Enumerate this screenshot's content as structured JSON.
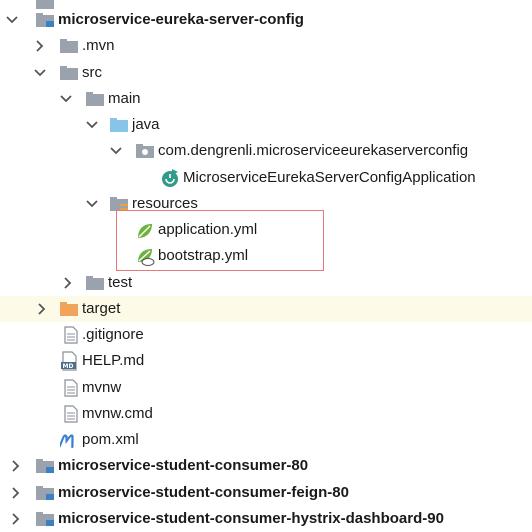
{
  "tree": {
    "root": {
      "label": "microservice-eureka-server-config"
    },
    "mvn": {
      "label": ".mvn"
    },
    "src": {
      "label": "src"
    },
    "main": {
      "label": "main"
    },
    "java": {
      "label": "java"
    },
    "package": {
      "label": "com.dengrenli.microserviceeurekaserverconfig"
    },
    "app_class": {
      "label": "MicroserviceEurekaServerConfigApplication"
    },
    "resources": {
      "label": "resources"
    },
    "application_yml": {
      "label": "application.yml"
    },
    "bootstrap_yml": {
      "label": "bootstrap.yml"
    },
    "test": {
      "label": "test"
    },
    "target": {
      "label": "target"
    },
    "gitignore": {
      "label": ".gitignore"
    },
    "help_md": {
      "label": "HELP.md"
    },
    "mvnw": {
      "label": "mvnw"
    },
    "mvnw_cmd": {
      "label": "mvnw.cmd"
    },
    "pom_xml": {
      "label": "pom.xml"
    },
    "module_consumer": {
      "label": "microservice-student-consumer-80"
    },
    "module_feign": {
      "label": "microservice-student-consumer-feign-80"
    },
    "module_hystrix": {
      "label": "microservice-student-consumer-hystrix-dashboard-90"
    }
  },
  "colors": {
    "selected_row": "#fdfbe7",
    "highlight_border": "#e7777b",
    "folder_gray": "#9aa3ad",
    "folder_blue": "#87c4ea",
    "folder_orange": "#f0a35a",
    "spring_green": "#6db33f"
  }
}
